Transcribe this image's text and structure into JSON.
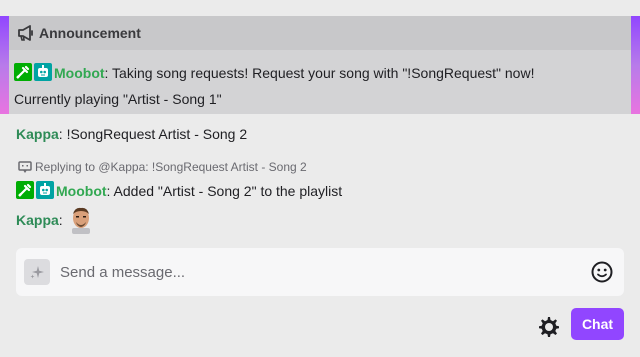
{
  "announcement": {
    "header": "Announcement",
    "username": "Moobot",
    "separator": ":",
    "text_line1": " Taking song requests! Request your song with \"!SongRequest\" now!",
    "text_line2": "Currently playing \"Artist - Song 1\"",
    "accent_gradient": [
      "#9146ff",
      "#e874e0"
    ]
  },
  "messages": [
    {
      "username": "Kappa",
      "separator": ":",
      "text": " !SongRequest Artist - Song 2"
    },
    {
      "reply": "Replying to @Kappa: !SongRequest Artist - Song 2",
      "username": "Moobot",
      "separator": ":",
      "text": " Added \"Artist - Song 2\" to the playlist"
    },
    {
      "username": "Kappa",
      "separator": ":",
      "emote": "kappa-emote"
    }
  ],
  "input": {
    "placeholder": "Send a message..."
  },
  "buttons": {
    "chat": "Chat"
  },
  "colors": {
    "accent": "#9146ff",
    "moobot": "#32a852",
    "kappa": "#2e8b57",
    "mod_badge": "#00ad03",
    "bot_badge": "#00a3a3"
  },
  "icons": [
    "megaphone-icon",
    "moderator-badge-icon",
    "bot-badge-icon",
    "reply-icon",
    "sparkle-icon",
    "emoji-icon",
    "gear-icon"
  ]
}
